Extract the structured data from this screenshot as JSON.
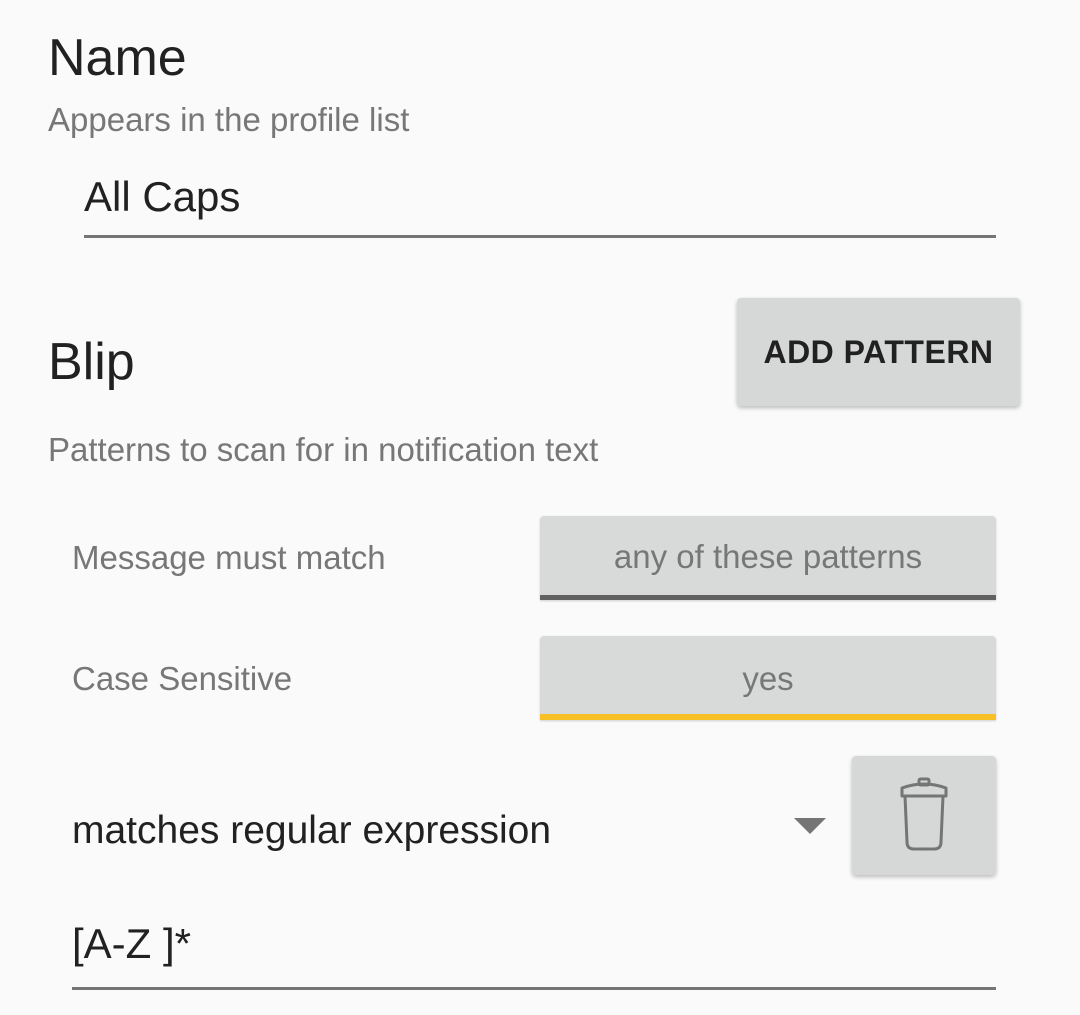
{
  "name_section": {
    "title": "Name",
    "subtitle": "Appears in the profile list",
    "value": "All Caps"
  },
  "blip_section": {
    "title": "Blip",
    "add_pattern_label": "ADD PATTERN",
    "subtitle": "Patterns to scan for in notification text",
    "match_row": {
      "label": "Message must match",
      "value": "any of these patterns"
    },
    "case_row": {
      "label": "Case Sensitive",
      "value": "yes"
    },
    "pattern": {
      "matcher": "matches regular expression",
      "value": "[A-Z ]*"
    }
  },
  "icons": {
    "dropdown": "chevron-down-icon",
    "delete": "trash-icon"
  },
  "colors": {
    "accent": "#f6c026",
    "button_bg": "#d6d7d7",
    "background": "#fafafa"
  }
}
